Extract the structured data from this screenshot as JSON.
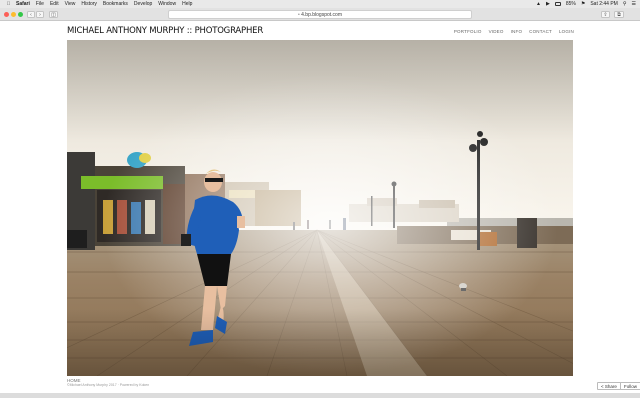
{
  "menubar": {
    "app": "Safari",
    "items": [
      "File",
      "Edit",
      "View",
      "History",
      "Bookmarks",
      "Develop",
      "Window",
      "Help"
    ],
    "battery": "85%",
    "clock": "Sat 2:44 PM"
  },
  "browser": {
    "url": "4.bp.blogspot.com"
  },
  "site": {
    "title": "MICHAEL ANTHONY MURPHY :: PHOTOGRAPHER",
    "nav": [
      "PORTFOLIO",
      "VIDEO",
      "INFO",
      "CONTACT",
      "LOGIN"
    ]
  },
  "caption": {
    "title": "HOME",
    "subtitle": "©Michael Anthony Murphy 2017 · Powered by Koken"
  },
  "buttons": {
    "share": "< Share",
    "follow": "Follow"
  }
}
